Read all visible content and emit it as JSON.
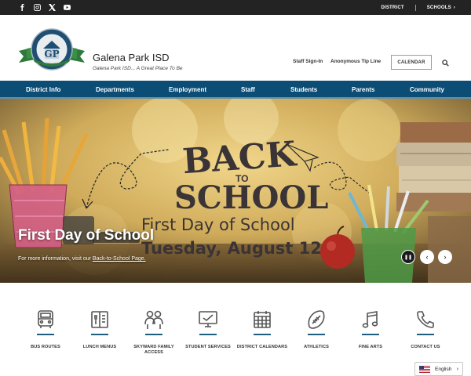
{
  "topbar": {
    "social": [
      {
        "name": "facebook-icon"
      },
      {
        "name": "instagram-icon"
      },
      {
        "name": "x-icon"
      },
      {
        "name": "youtube-icon"
      }
    ],
    "district_label": "DISTRICT",
    "schools_label": "SCHOOLS"
  },
  "header": {
    "logo_text": "GP",
    "logo_ring_text": "Galena Park ISD",
    "title": "Galena Park ISD",
    "tagline": "Galena Park ISD... A Great Place To Be",
    "staff_signin": "Staff Sign-In",
    "tip_line": "Anonymous Tip Line",
    "calendar": "CALENDAR"
  },
  "nav": {
    "items": [
      {
        "label": "District Info"
      },
      {
        "label": "Departments"
      },
      {
        "label": "Employment"
      },
      {
        "label": "Staff"
      },
      {
        "label": "Students"
      },
      {
        "label": "Parents"
      },
      {
        "label": "Community"
      }
    ]
  },
  "hero": {
    "title": "First Day of School",
    "caption_prefix": "For more information, visit our ",
    "caption_link": "Back-to-School Page.",
    "image_text_line1": "BACK",
    "image_text_to": "TO",
    "image_text_line2": "SCHOOL",
    "image_text_line3": "First Day of School",
    "image_text_line4": "Tuesday, August 12"
  },
  "quicklinks": [
    {
      "label": "BUS ROUTES",
      "icon": "bus-icon"
    },
    {
      "label": "LUNCH MENUS",
      "icon": "lunch-menu-icon"
    },
    {
      "label": "SKYWARD FAMILY ACCESS",
      "icon": "family-access-icon"
    },
    {
      "label": "STUDENT SERVICES",
      "icon": "student-services-icon"
    },
    {
      "label": "DISTRICT CALENDARS",
      "icon": "calendar-icon"
    },
    {
      "label": "ATHLETICS",
      "icon": "football-icon"
    },
    {
      "label": "FINE ARTS",
      "icon": "music-note-icon"
    },
    {
      "label": "CONTACT US",
      "icon": "phone-icon"
    }
  ],
  "language": {
    "selected": "English",
    "flag": "us-flag-icon"
  },
  "colors": {
    "nav_bg": "#0b4d74",
    "topbar_bg": "#232323",
    "accent_underline": "#1e5d7c"
  }
}
